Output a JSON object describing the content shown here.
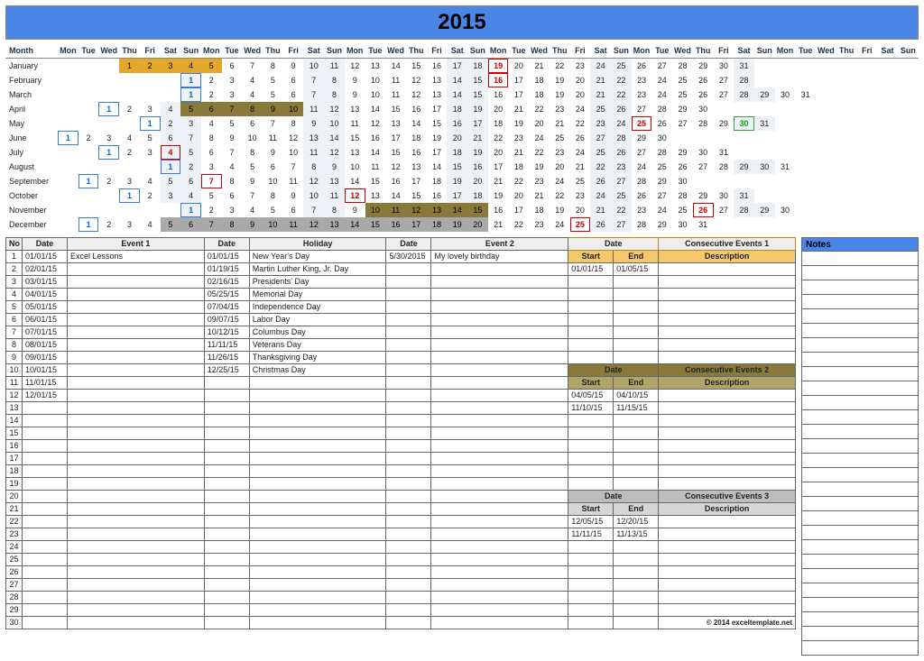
{
  "title": "2015",
  "dow": [
    "Mon",
    "Tue",
    "Wed",
    "Thu",
    "Fri",
    "Sat",
    "Sun"
  ],
  "dow_repeat": 6,
  "month_header": "Month",
  "months": [
    {
      "name": "January",
      "offset": 3,
      "days": 31,
      "marks": {
        "red": [
          19
        ],
        "gold": [
          1,
          2,
          3,
          4,
          5
        ]
      },
      "weekend_sun": true
    },
    {
      "name": "February",
      "offset": 6,
      "days": 28,
      "marks": {
        "blue": [
          1
        ],
        "red": [
          16
        ]
      }
    },
    {
      "name": "March",
      "offset": 6,
      "days": 31,
      "marks": {
        "blue": [
          1
        ]
      }
    },
    {
      "name": "April",
      "offset": 2,
      "days": 30,
      "marks": {
        "blue": [
          1
        ],
        "olive": [
          5,
          6,
          7,
          8,
          9,
          10
        ]
      }
    },
    {
      "name": "May",
      "offset": 4,
      "days": 31,
      "marks": {
        "blue": [
          1
        ],
        "red": [
          25
        ],
        "green": [
          30
        ]
      }
    },
    {
      "name": "June",
      "offset": 0,
      "days": 30,
      "marks": {
        "blue": [
          1
        ]
      }
    },
    {
      "name": "July",
      "offset": 2,
      "days": 31,
      "marks": {
        "blue": [
          1
        ],
        "red": [
          4
        ]
      }
    },
    {
      "name": "August",
      "offset": 5,
      "days": 31,
      "marks": {
        "blue": [
          1
        ]
      }
    },
    {
      "name": "September",
      "offset": 1,
      "days": 30,
      "marks": {
        "blue": [
          1
        ],
        "red": [
          7
        ]
      }
    },
    {
      "name": "October",
      "offset": 3,
      "days": 31,
      "marks": {
        "blue": [
          1
        ],
        "red": [
          12
        ]
      }
    },
    {
      "name": "November",
      "offset": 6,
      "days": 30,
      "marks": {
        "blue": [
          1
        ],
        "olive": [
          10,
          11,
          12,
          13,
          14,
          15
        ],
        "red": [
          26
        ]
      }
    },
    {
      "name": "December",
      "offset": 1,
      "days": 31,
      "marks": {
        "blue": [
          1
        ],
        "grey": [
          5,
          6,
          7,
          8,
          9,
          10,
          11,
          12,
          13,
          14,
          15,
          16,
          17,
          18,
          19,
          20
        ],
        "red": [
          25
        ]
      }
    }
  ],
  "tables": {
    "no_label": "No",
    "date_label": "Date",
    "event1": {
      "label": "Event 1",
      "rows": [
        {
          "date": "01/01/15",
          "text": "Excel Lessons"
        },
        {
          "date": "02/01/15"
        },
        {
          "date": "03/01/15"
        },
        {
          "date": "04/01/15"
        },
        {
          "date": "05/01/15"
        },
        {
          "date": "06/01/15"
        },
        {
          "date": "07/01/15"
        },
        {
          "date": "08/01/15"
        },
        {
          "date": "09/01/15"
        },
        {
          "date": "10/01/15"
        },
        {
          "date": "11/01/15"
        },
        {
          "date": "12/01/15"
        }
      ],
      "total_rows": 30
    },
    "holiday": {
      "label": "Holiday",
      "rows": [
        {
          "date": "01/01/15",
          "text": "New Year's Day"
        },
        {
          "date": "01/19/15",
          "text": "Martin Luther King, Jr. Day"
        },
        {
          "date": "02/16/15",
          "text": "Presidents' Day"
        },
        {
          "date": "05/25/15",
          "text": "Memorial Day"
        },
        {
          "date": "07/04/15",
          "text": "Independence Day"
        },
        {
          "date": "09/07/15",
          "text": "Labor Day"
        },
        {
          "date": "10/12/15",
          "text": "Columbus Day"
        },
        {
          "date": "11/11/15",
          "text": "Veterans Day"
        },
        {
          "date": "11/26/15",
          "text": "Thanksgiving Day"
        },
        {
          "date": "12/25/15",
          "text": "Christmas Day"
        }
      ],
      "total_rows": 30
    },
    "event2": {
      "label": "Event 2",
      "rows": [
        {
          "date": "5/30/2015",
          "text": "My lovely birthday"
        }
      ],
      "total_rows": 30
    },
    "ce_date_label": "Date",
    "ce_start": "Start",
    "ce_end": "End",
    "ce_desc": "Description",
    "ce1": {
      "label": "Consecutive Events 1",
      "rows": [
        {
          "start": "01/01/15",
          "end": "01/05/15"
        }
      ],
      "total_rows": 8
    },
    "ce2": {
      "label": "Consecutive Events 2",
      "rows": [
        {
          "start": "04/05/15",
          "end": "04/10/15"
        },
        {
          "start": "11/10/15",
          "end": "11/15/15"
        }
      ],
      "total_rows": 8
    },
    "ce3": {
      "label": "Consecutive Events 3",
      "rows": [
        {
          "start": "12/05/15",
          "end": "12/20/15"
        },
        {
          "start": "11/11/15",
          "end": "11/13/15"
        }
      ],
      "total_rows": 8
    }
  },
  "notes_label": "Notes",
  "notes_rows": 28,
  "copyright": "© 2014 exceltemplate.net"
}
